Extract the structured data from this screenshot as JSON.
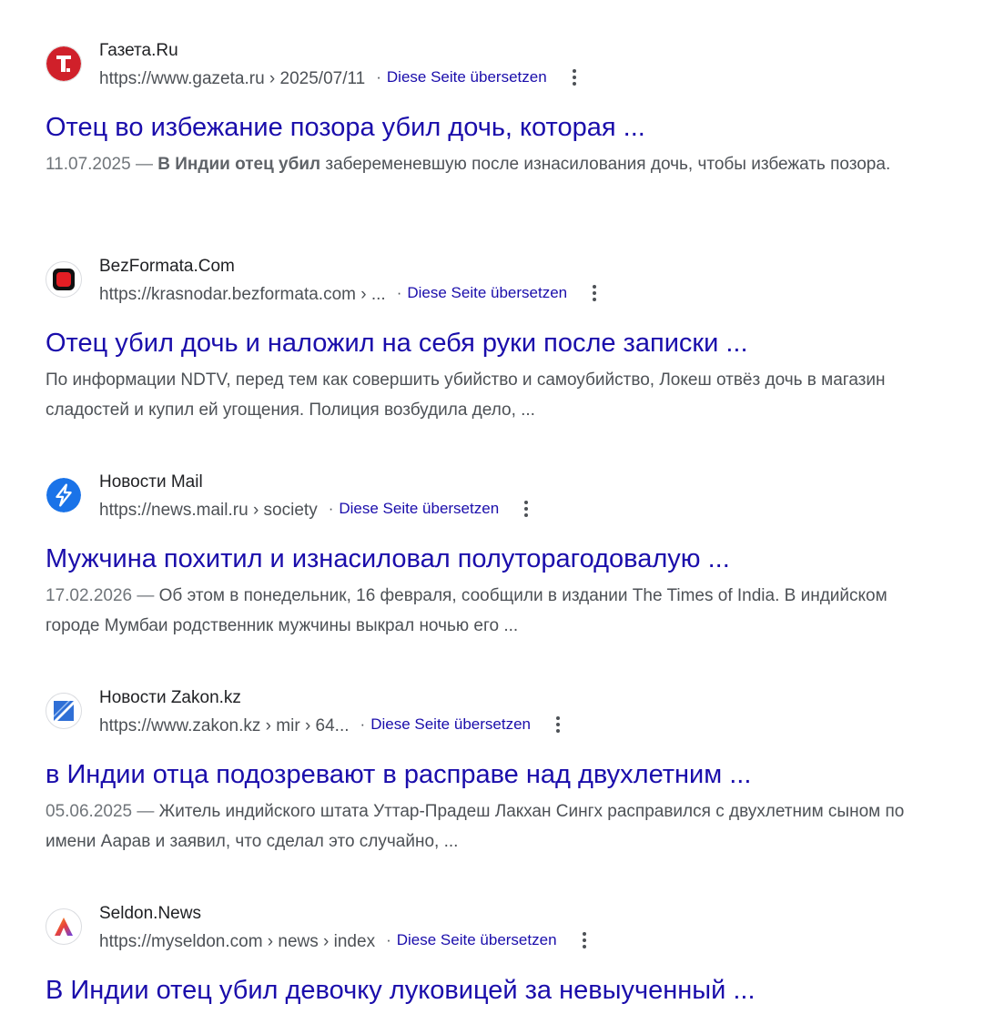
{
  "results": [
    {
      "site_name": "Газета.Ru",
      "url": "https://www.gazeta.ru › 2025/07/11",
      "translate": "Diese Seite übersetzen",
      "title": "Отец во избежание позора убил дочь, которая ...",
      "date": "11.07.2025 — ",
      "snippet_bold": "В Индии отец убил",
      "snippet": " забеременевшую после изнасилования дочь, чтобы избежать позора.",
      "favicon": "gazeta-icon",
      "favicon_color": "#d0202a"
    },
    {
      "site_name": "BezFormata.Com",
      "url": "https://krasnodar.bezformata.com › ...",
      "translate": "Diese Seite übersetzen",
      "title": "Отец убил дочь и наложил на себя руки после записки ...",
      "date": "",
      "snippet_bold": "",
      "snippet": "По информации NDTV, перед тем как совершить убийство и самоубийство, Локеш отвёз дочь в магазин сладостей и купил ей угощения. Полиция возбудила дело, ...",
      "favicon": "bezformata-icon",
      "favicon_color": "#e31e24"
    },
    {
      "site_name": "Новости Mail",
      "url": "https://news.mail.ru › society",
      "translate": "Diese Seite übersetzen",
      "title": "Мужчина похитил и изнасиловал полуторагодовалую ...",
      "date": "17.02.2026 — ",
      "snippet_bold": "",
      "snippet": "Об этом в понедельник, 16 февраля, сообщили в издании The Times of India. В индийском городе Мумбаи родственник мужчины выкрал ночью его ...",
      "favicon": "mail-news-icon",
      "favicon_color": "#1a73e8"
    },
    {
      "site_name": "Новости Zakon.kz",
      "url": "https://www.zakon.kz › mir › 64...",
      "translate": "Diese Seite übersetzen",
      "title": "в Индии отца подозревают в расправе над двухлетним ...",
      "date": "05.06.2025 — ",
      "snippet_bold": "",
      "snippet": "Житель индийского штата Уттар-Прадеш Лакхан Сингх расправился с двухлетним сыном по имени Аарав и заявил, что сделал это случайно, ...",
      "favicon": "zakon-icon",
      "favicon_color": "#2f6fd6"
    },
    {
      "site_name": "Seldon.News",
      "url": "https://myseldon.com › news › index",
      "translate": "Diese Seite übersetzen",
      "title": "В Индии отец убил девочку луковицей за невыученный ...",
      "date": "",
      "snippet_bold": "",
      "snippet": "",
      "favicon": "seldon-icon",
      "favicon_color": "#7b3fe4"
    }
  ]
}
